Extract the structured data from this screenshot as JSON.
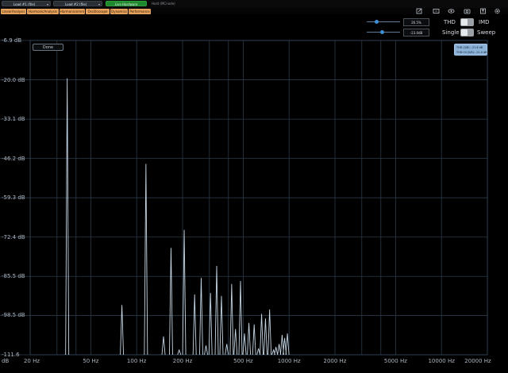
{
  "slots": [
    {
      "label": "Load #1 (file)",
      "style": "dark"
    },
    {
      "label": "Load #2 (file)",
      "style": "dark"
    },
    {
      "label": "Live Hardware",
      "style": "green"
    },
    {
      "label": "Hold (MCnode)",
      "style": "plain"
    }
  ],
  "tabs": [
    "LinearAnalysis",
    "HarmonicAnalysis",
    "Harmonicsimm",
    "Oscilloscope",
    "Dynamics",
    "Performance"
  ],
  "toolbar_icons": [
    "edit-icon",
    "screen-icon",
    "eye-icon",
    "camera-icon",
    "export-icon",
    "settings-icon"
  ],
  "controls": {
    "level_value": "26.5%",
    "gain_value": "-23.0dB",
    "thd_label": "THD",
    "imd_label": "IMD",
    "single_label": "Single",
    "sweep_label": "Sweep"
  },
  "done_label": "Done",
  "readout": {
    "line1": "THD (0/B):  -21.6 dB",
    "line2": "THD+N (0/B):  -21.0 dB"
  },
  "chart_data": {
    "type": "bar",
    "x_scale": "log",
    "xlim": [
      20,
      20000
    ],
    "ylim": [
      -111.6,
      -6.9
    ],
    "y_ticks": [
      "-6.9 dB",
      "-20.0 dB",
      "-33.1 dB",
      "-46.2 dB",
      "-59.3 dB",
      "-72.4 dB",
      "-85.5 dB",
      "-98.5 dB",
      "-111.6 dB"
    ],
    "y_tick_values": [
      -6.9,
      -20.0,
      -33.1,
      -46.2,
      -59.3,
      -72.4,
      -85.5,
      -98.5,
      -111.6
    ],
    "x_ticks": [
      "20 Hz",
      "50 Hz",
      "100 Hz",
      "200 Hz",
      "500 Hz",
      "1000 Hz",
      "2000 Hz",
      "5000 Hz",
      "10000 Hz",
      "20000 Hz"
    ],
    "x_tick_values": [
      20,
      50,
      100,
      200,
      500,
      1000,
      2000,
      5000,
      10000,
      20000
    ],
    "x_minor_values": [
      30,
      40,
      300,
      400,
      3000,
      4000
    ],
    "peaks": [
      {
        "x": 35,
        "y": -19.5
      },
      {
        "x": 80,
        "y": -95.0
      },
      {
        "x": 115,
        "y": -48.0
      },
      {
        "x": 150,
        "y": -105.5
      },
      {
        "x": 168,
        "y": -76.0
      },
      {
        "x": 190,
        "y": -110.0
      },
      {
        "x": 205,
        "y": -70.0
      },
      {
        "x": 240,
        "y": -91.5
      },
      {
        "x": 265,
        "y": -86.0
      },
      {
        "x": 285,
        "y": -108.5
      },
      {
        "x": 305,
        "y": -91.0
      },
      {
        "x": 335,
        "y": -82.0
      },
      {
        "x": 360,
        "y": -92.0
      },
      {
        "x": 390,
        "y": -108.0
      },
      {
        "x": 420,
        "y": -88.0
      },
      {
        "x": 445,
        "y": -103.0
      },
      {
        "x": 480,
        "y": -87.0
      },
      {
        "x": 510,
        "y": -104.5
      },
      {
        "x": 545,
        "y": -101.0
      },
      {
        "x": 590,
        "y": -101.5
      },
      {
        "x": 630,
        "y": -109.5
      },
      {
        "x": 660,
        "y": -98.0
      },
      {
        "x": 700,
        "y": -99.5
      },
      {
        "x": 745,
        "y": -96.5
      },
      {
        "x": 790,
        "y": -110.0
      },
      {
        "x": 820,
        "y": -109.0
      },
      {
        "x": 860,
        "y": -108.0
      },
      {
        "x": 900,
        "y": -105.0
      },
      {
        "x": 935,
        "y": -106.0
      },
      {
        "x": 975,
        "y": -104.5
      }
    ]
  }
}
